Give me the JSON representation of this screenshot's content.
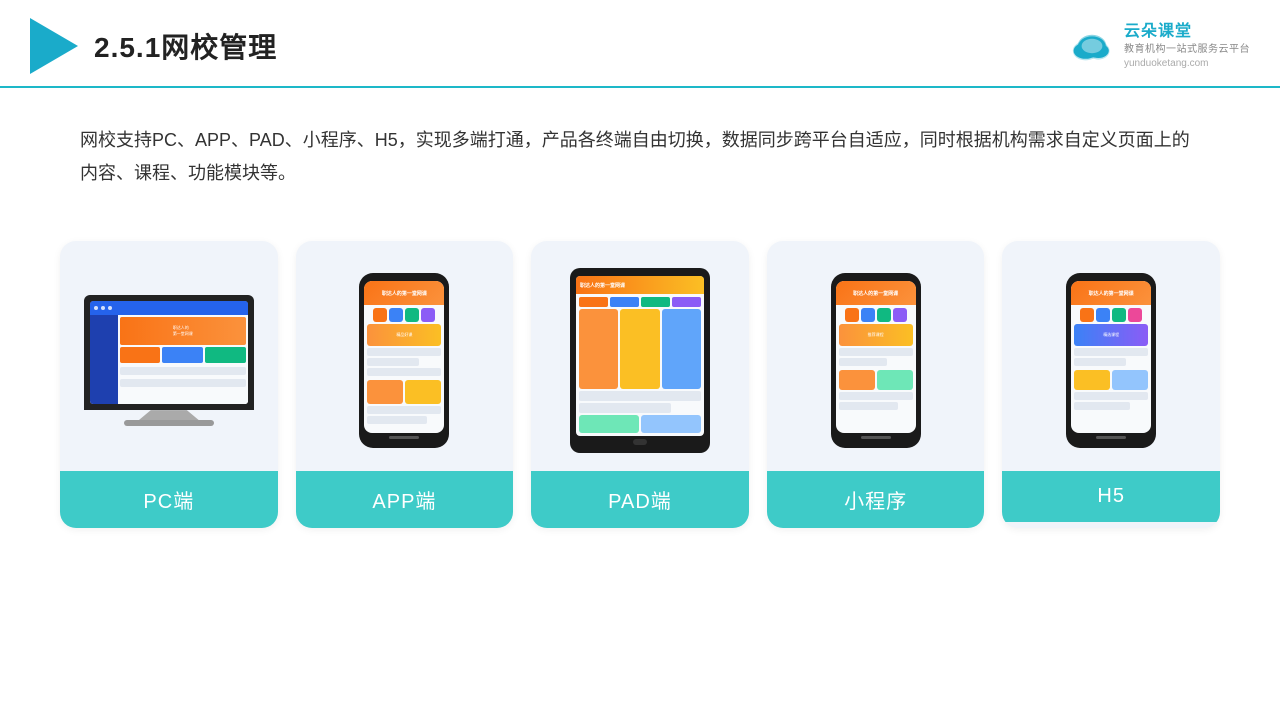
{
  "header": {
    "title": "2.5.1网校管理",
    "brand_name": "云朵课堂",
    "brand_url": "yunduoketang.com",
    "brand_tagline_line1": "教育机构一站",
    "brand_tagline_line2": "式服务云平台"
  },
  "description": "网校支持PC、APP、PAD、小程序、H5，实现多端打通，产品各终端自由切换，数据同步跨平台自适应，同时根据机构需求自定义页面上的内容、课程、功能模块等。",
  "cards": [
    {
      "id": "pc",
      "label": "PC端"
    },
    {
      "id": "app",
      "label": "APP端"
    },
    {
      "id": "pad",
      "label": "PAD端"
    },
    {
      "id": "mini",
      "label": "小程序"
    },
    {
      "id": "h5",
      "label": "H5"
    }
  ],
  "colors": {
    "teal": "#3ecbc8",
    "accent": "#1aabca",
    "header_border": "#1db8c8"
  }
}
